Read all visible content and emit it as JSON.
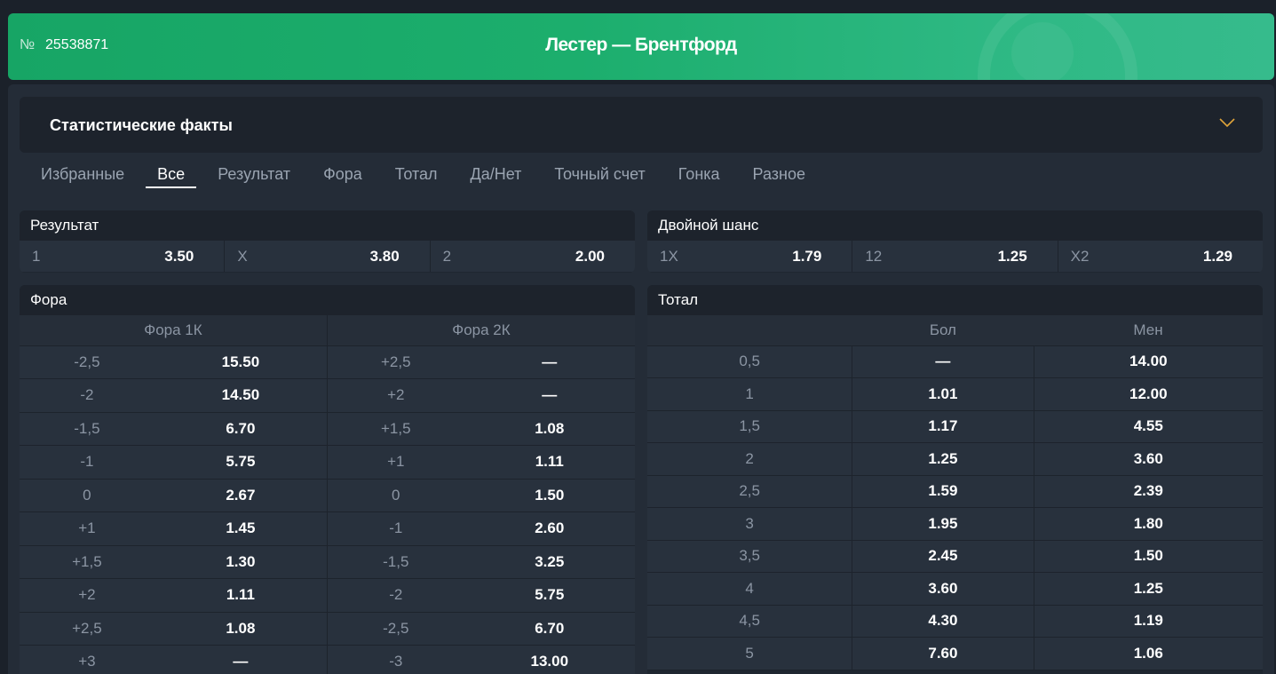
{
  "header": {
    "num_label": "№",
    "event_id": "25538871",
    "title": "Лестер — Брентфорд"
  },
  "facts": {
    "label": "Статистические факты"
  },
  "tabs": [
    "Избранные",
    "Все",
    "Результат",
    "Фора",
    "Тотал",
    "Да/Нет",
    "Точный счет",
    "Гонка",
    "Разное"
  ],
  "active_tab": "Все",
  "result": {
    "title": "Результат",
    "odds": [
      {
        "name": "1",
        "value": "3.50"
      },
      {
        "name": "X",
        "value": "3.80"
      },
      {
        "name": "2",
        "value": "2.00"
      }
    ]
  },
  "double_chance": {
    "title": "Двойной шанс",
    "odds": [
      {
        "name": "1X",
        "value": "1.79"
      },
      {
        "name": "12",
        "value": "1.25"
      },
      {
        "name": "X2",
        "value": "1.29"
      }
    ]
  },
  "handicap": {
    "title": "Фора",
    "col1": "Фора 1К",
    "col2": "Фора 2К",
    "rows": [
      {
        "h1": "-2,5",
        "o1": "15.50",
        "h2": "+2,5",
        "o2": "—"
      },
      {
        "h1": "-2",
        "o1": "14.50",
        "h2": "+2",
        "o2": "—"
      },
      {
        "h1": "-1,5",
        "o1": "6.70",
        "h2": "+1,5",
        "o2": "1.08"
      },
      {
        "h1": "-1",
        "o1": "5.75",
        "h2": "+1",
        "o2": "1.11"
      },
      {
        "h1": "0",
        "o1": "2.67",
        "h2": "0",
        "o2": "1.50"
      },
      {
        "h1": "+1",
        "o1": "1.45",
        "h2": "-1",
        "o2": "2.60"
      },
      {
        "h1": "+1,5",
        "o1": "1.30",
        "h2": "-1,5",
        "o2": "3.25"
      },
      {
        "h1": "+2",
        "o1": "1.11",
        "h2": "-2",
        "o2": "5.75"
      },
      {
        "h1": "+2,5",
        "o1": "1.08",
        "h2": "-2,5",
        "o2": "6.70"
      },
      {
        "h1": "+3",
        "o1": "—",
        "h2": "-3",
        "o2": "13.00"
      }
    ]
  },
  "total": {
    "title": "Тотал",
    "col_over": "Бол",
    "col_under": "Мен",
    "rows": [
      {
        "line": "0,5",
        "over": "—",
        "under": "14.00"
      },
      {
        "line": "1",
        "over": "1.01",
        "under": "12.00"
      },
      {
        "line": "1,5",
        "over": "1.17",
        "under": "4.55"
      },
      {
        "line": "2",
        "over": "1.25",
        "under": "3.60"
      },
      {
        "line": "2,5",
        "over": "1.59",
        "under": "2.39"
      },
      {
        "line": "3",
        "over": "1.95",
        "under": "1.80"
      },
      {
        "line": "3,5",
        "over": "2.45",
        "under": "1.50"
      },
      {
        "line": "4",
        "over": "3.60",
        "under": "1.25"
      },
      {
        "line": "4,5",
        "over": "4.30",
        "under": "1.19"
      },
      {
        "line": "5",
        "over": "7.60",
        "under": "1.06"
      }
    ]
  },
  "colors": {
    "header_gradient_start": "#17a565",
    "header_gradient_end": "#36bb8c",
    "chevron": "#e0a43a",
    "background": "#1b212a"
  }
}
